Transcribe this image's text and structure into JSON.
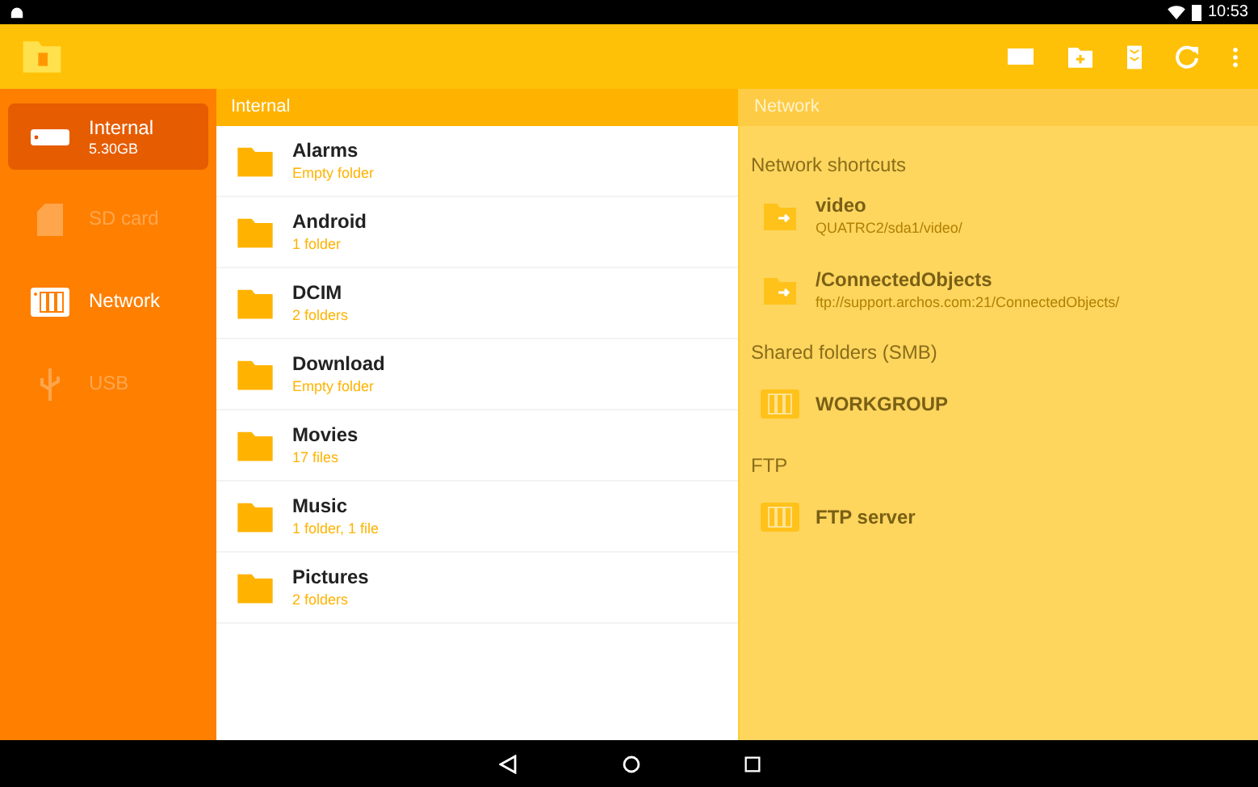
{
  "status_bar": {
    "time": "10:53"
  },
  "sidebar": {
    "items": [
      {
        "label": "Internal",
        "detail": "5.30GB",
        "kind": "internal",
        "selected": true,
        "disabled": false
      },
      {
        "label": "SD card",
        "kind": "sdcard",
        "selected": false,
        "disabled": true
      },
      {
        "label": "Network",
        "kind": "network",
        "selected": false,
        "disabled": false
      },
      {
        "label": "USB",
        "kind": "usb",
        "selected": false,
        "disabled": true
      }
    ]
  },
  "file_panel": {
    "title": "Internal",
    "items": [
      {
        "name": "Alarms",
        "detail": "Empty folder"
      },
      {
        "name": "Android",
        "detail": "1 folder"
      },
      {
        "name": "DCIM",
        "detail": "2 folders"
      },
      {
        "name": "Download",
        "detail": "Empty folder"
      },
      {
        "name": "Movies",
        "detail": "17 files"
      },
      {
        "name": "Music",
        "detail": "1 folder, 1 file"
      },
      {
        "name": "Pictures",
        "detail": "2 folders"
      }
    ]
  },
  "network_panel": {
    "title": "Network",
    "sections": [
      {
        "heading": "Network shortcuts",
        "items": [
          {
            "kind": "shortcut",
            "name": "video",
            "path": "QUATRC2/sda1/video/"
          },
          {
            "kind": "shortcut",
            "name": "/ConnectedObjects",
            "path": "ftp://support.archos.com:21/ConnectedObjects/"
          }
        ]
      },
      {
        "heading": "Shared folders (SMB)",
        "items": [
          {
            "kind": "server",
            "name": "WORKGROUP"
          }
        ]
      },
      {
        "heading": "FTP",
        "items": [
          {
            "kind": "server",
            "name": "FTP server"
          }
        ]
      }
    ]
  }
}
